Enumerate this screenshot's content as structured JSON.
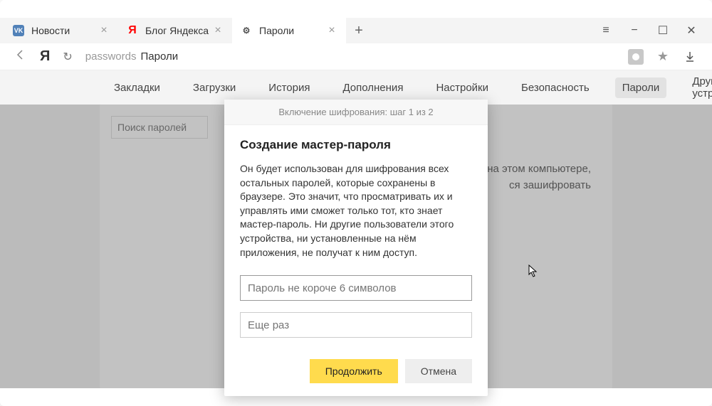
{
  "tabs": [
    {
      "icon": "vk",
      "title": "Новости"
    },
    {
      "icon": "ya",
      "title": "Блог Яндекса"
    },
    {
      "icon": "gear",
      "title": "Пароли",
      "active": true
    }
  ],
  "address": {
    "host": "passwords",
    "title": "Пароли"
  },
  "settings_nav": [
    "Закладки",
    "Загрузки",
    "История",
    "Дополнения",
    "Настройки",
    "Безопасность",
    "Пароли",
    "Другие устройства"
  ],
  "sidebar": {
    "search_placeholder": "Поиск паролей"
  },
  "main_hint_line1": "на этом компьютере,",
  "main_hint_line2": "ся зашифровать",
  "dialog": {
    "header": "Включение шифрования: шаг 1 из 2",
    "title": "Создание мастер-пароля",
    "text": "Он будет использован для шифрования всех остальных паролей, которые сохранены в браузере. Это значит, что просматривать их и управлять ими сможет только тот, кто знает мастер-пароль. Ни другие пользователи этого устройства, ни установленные на нём приложения, не получат к ним доступ.",
    "input1_placeholder": "Пароль не короче 6 символов",
    "input2_placeholder": "Еще раз",
    "continue": "Продолжить",
    "cancel": "Отмена"
  },
  "icons": {
    "vk_text": "VK",
    "ya_text": "Я",
    "gear_text": "⚙",
    "plus": "+",
    "close": "×",
    "menu": "≡",
    "minimize": "−",
    "maximize": "☐",
    "win_close": "✕",
    "back": "←",
    "reload": "↻",
    "star": "★",
    "download": "↓",
    "cursor": "➤"
  }
}
